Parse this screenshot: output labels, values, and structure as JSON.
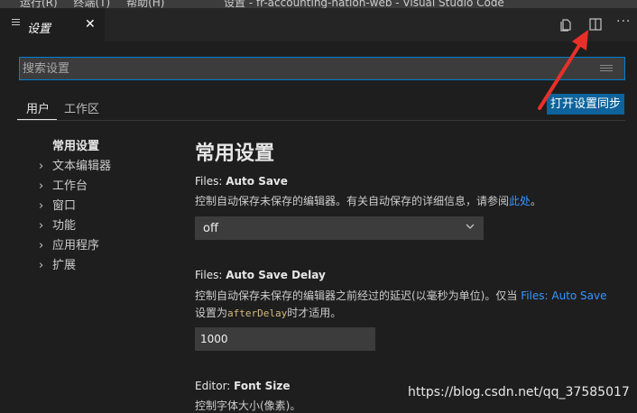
{
  "menubar": {
    "items": [
      "运行(R)",
      "终端(T)",
      "帮助(H)"
    ]
  },
  "window": {
    "title": "设置 - fr-accounting-nation-web - Visual Studio Code"
  },
  "tab": {
    "title": "设置",
    "close": "✕",
    "icon": "list-icon"
  },
  "toolbar": {
    "open_json_icon": "open-json-icon",
    "split_icon": "split-editor-icon",
    "more": "···"
  },
  "search": {
    "placeholder": "搜索设置",
    "value": ""
  },
  "scope_tabs": {
    "user": "用户",
    "workspace": "工作区"
  },
  "sync_button": "打开设置同步",
  "toc": {
    "items": [
      {
        "label": "常用设置",
        "expandable": false
      },
      {
        "label": "文本编辑器",
        "expandable": true
      },
      {
        "label": "工作台",
        "expandable": true
      },
      {
        "label": "窗口",
        "expandable": true
      },
      {
        "label": "功能",
        "expandable": true
      },
      {
        "label": "应用程序",
        "expandable": true
      },
      {
        "label": "扩展",
        "expandable": true
      }
    ],
    "chevron": "›"
  },
  "section_title": "常用设置",
  "settings": {
    "auto_save": {
      "category": "Files: ",
      "name": "Auto Save",
      "desc_before": "控制自动保存未保存的编辑器。有关自动保存的详细信息，请参阅",
      "desc_link": "此处",
      "desc_after": "。",
      "value": "off"
    },
    "auto_save_delay": {
      "category": "Files: ",
      "name": "Auto Save Delay",
      "desc_line1": "控制自动保存未保存的编辑器之前经过的延迟(以毫秒为单位)。仅当 ",
      "desc_link": "Files: Auto Save",
      "desc_line2_before": "设置为",
      "desc_code": "afterDelay",
      "desc_line2_after": "时才适用。",
      "value": "1000"
    },
    "font_size": {
      "category": "Editor: ",
      "name": "Font Size",
      "desc": "控制字体大小(像素)。"
    }
  },
  "watermark": "https://blog.csdn.net/qq_37585017",
  "colors": {
    "background": "#1e1e1e",
    "accent": "#007fd4",
    "button": "#0e639c",
    "link": "#3794ff",
    "annotation": "#e8302a"
  }
}
